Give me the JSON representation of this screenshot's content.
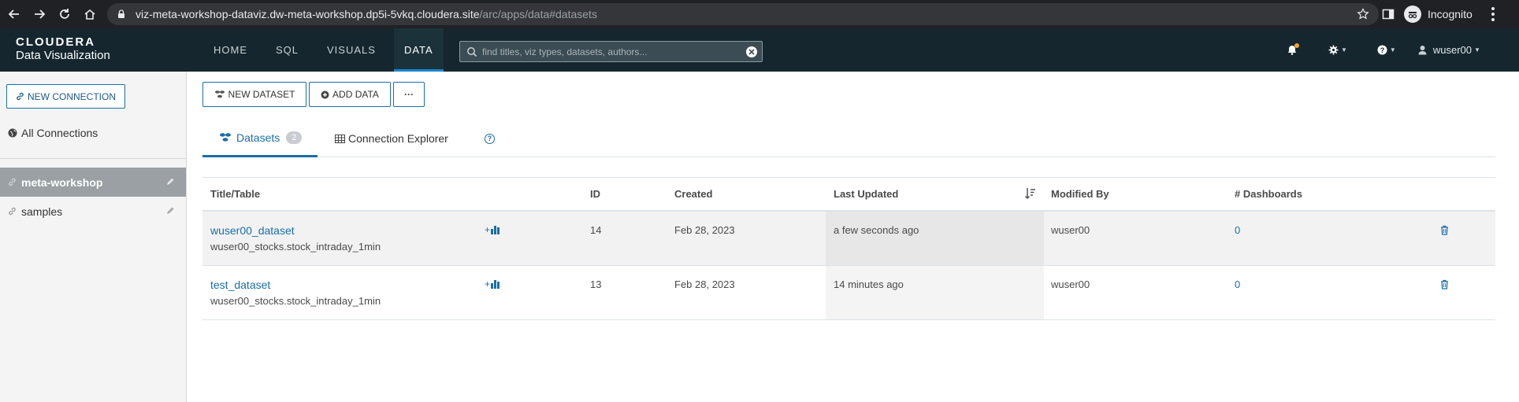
{
  "browser": {
    "url_host": "viz-meta-workshop-dataviz.dw-meta-workshop.dp5i-5vkq.cloudera.site",
    "url_path": "/arc/apps/data#datasets",
    "profile_label": "Incognito"
  },
  "app": {
    "brand": "CLOUDERA",
    "product": "Data Visualization",
    "nav": [
      "HOME",
      "SQL",
      "VISUALS",
      "DATA"
    ],
    "active_nav": "DATA",
    "search_placeholder": "find titles, viz types, datasets, authors...",
    "user": "wuser00",
    "accent_color": "#1b6ea8",
    "header_bg": "#15262e"
  },
  "sidebar": {
    "new_connection_label": "NEW CONNECTION",
    "all_connections_label": "All Connections",
    "connections": [
      {
        "label": "meta-workshop",
        "active": true
      },
      {
        "label": "samples",
        "active": false
      }
    ]
  },
  "toolbar": {
    "new_dataset_label": "NEW DATASET",
    "add_data_label": "ADD DATA",
    "more_label": "···"
  },
  "tabs": {
    "datasets_label": "Datasets",
    "datasets_count": "2",
    "explorer_label": "Connection Explorer",
    "help_label": "?"
  },
  "table": {
    "columns": [
      "Title/Table",
      "ID",
      "Created",
      "Last Updated",
      "Modified By",
      "# Dashboards"
    ],
    "rows": [
      {
        "title": "wuser00_dataset",
        "table": "wuser00_stocks.stock_intraday_1min",
        "id": "14",
        "created": "Feb 28, 2023",
        "last_updated": "a few seconds ago",
        "modified_by": "wuser00",
        "dashboards": "0"
      },
      {
        "title": "test_dataset",
        "table": "wuser00_stocks.stock_intraday_1min",
        "id": "13",
        "created": "Feb 28, 2023",
        "last_updated": "14 minutes ago",
        "modified_by": "wuser00",
        "dashboards": "0"
      }
    ]
  }
}
